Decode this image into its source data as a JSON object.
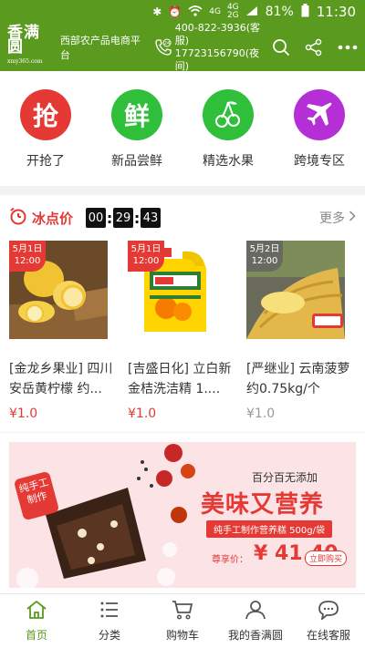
{
  "status_bar": {
    "network_4g": "4G",
    "network_4g_mini": "4G",
    "network_2g_mini": "2G",
    "battery": "81%",
    "time": "11:30"
  },
  "header": {
    "logo_text": "香满圆",
    "logo_sub": "xmy365.com",
    "slogan": "西部农产品电商平台",
    "phone_day": "400-822-3936(客服)",
    "phone_night": "17723156790(夜间)",
    "icons": [
      "search-icon",
      "share-icon",
      "more-icon"
    ]
  },
  "categories": [
    {
      "label": "开抢了",
      "glyph": "抢",
      "color": "#e53935"
    },
    {
      "label": "新品尝鲜",
      "glyph": "鲜",
      "color": "#2fbf3a"
    },
    {
      "label": "精选水果",
      "glyph": "cherry",
      "color": "#2fbf3a"
    },
    {
      "label": "跨境专区",
      "glyph": "plane",
      "color": "#b52fd6"
    }
  ],
  "flash_sale": {
    "title": "冰点价",
    "timer": {
      "h": "00",
      "m": "29",
      "s": "43"
    },
    "more_label": "更多",
    "products": [
      {
        "date": "5月1日",
        "time": "12:00",
        "name": "[金龙乡果业] 四川安岳黄柠檬 约...",
        "price": "¥1.0",
        "tag_color": "red"
      },
      {
        "date": "5月1日",
        "time": "12:00",
        "name": "[吉盛日化] 立白新金桔洗洁精 1....",
        "price": "¥1.0",
        "tag_color": "red"
      },
      {
        "date": "5月2日",
        "time": "12:00",
        "name": "[严继业] 云南菠萝约0.75kg/个",
        "price": "¥1.0",
        "tag_color": "gray"
      }
    ]
  },
  "banner": {
    "badge": "纯手工制作",
    "line1": "百分百无添加",
    "headline": "美味又营养",
    "subtitle": "纯手工制作营养糕 500g/袋",
    "price_label": "尊享价：",
    "price": "¥ 41.40",
    "buy_button": "立即购买"
  },
  "bottom_nav": [
    {
      "label": "首页",
      "icon": "home-icon",
      "active": true
    },
    {
      "label": "分类",
      "icon": "list-icon",
      "active": false
    },
    {
      "label": "购物车",
      "icon": "cart-icon",
      "active": false
    },
    {
      "label": "我的香满圆",
      "icon": "user-icon",
      "active": false
    },
    {
      "label": "在线客服",
      "icon": "chat-icon",
      "active": false
    }
  ]
}
